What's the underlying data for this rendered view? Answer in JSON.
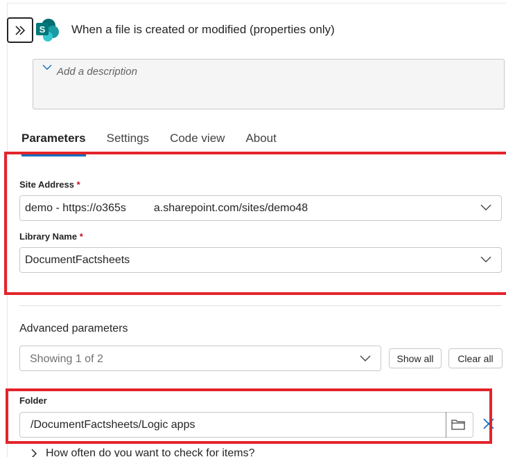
{
  "trigger": {
    "title": "When a file is created or modified (properties only)",
    "description_placeholder": "Add a description",
    "icon": "sharepoint-logo-icon",
    "brand_color": "#038387"
  },
  "tabs": [
    {
      "label": "Parameters",
      "active": true
    },
    {
      "label": "Settings",
      "active": false
    },
    {
      "label": "Code view",
      "active": false
    },
    {
      "label": "About",
      "active": false
    }
  ],
  "parameters": {
    "site_address": {
      "label": "Site Address",
      "required_mark": "*",
      "value": "demo - https://o365s     a.sharepoint.com/sites/demo48"
    },
    "library_name": {
      "label": "Library Name",
      "required_mark": "*",
      "value": "DocumentFactsheets"
    }
  },
  "advanced": {
    "title": "Advanced parameters",
    "select_value": "Showing 1 of 2",
    "show_all_label": "Show all",
    "clear_all_label": "Clear all"
  },
  "folder": {
    "label": "Folder",
    "value": "/DocumentFactsheets/Logic apps"
  },
  "next_param": {
    "label": "How often do you want to check for items?"
  },
  "colors": {
    "accent": "#0f6cbd",
    "highlight": "#e3242b",
    "required": "#c50f1f"
  }
}
